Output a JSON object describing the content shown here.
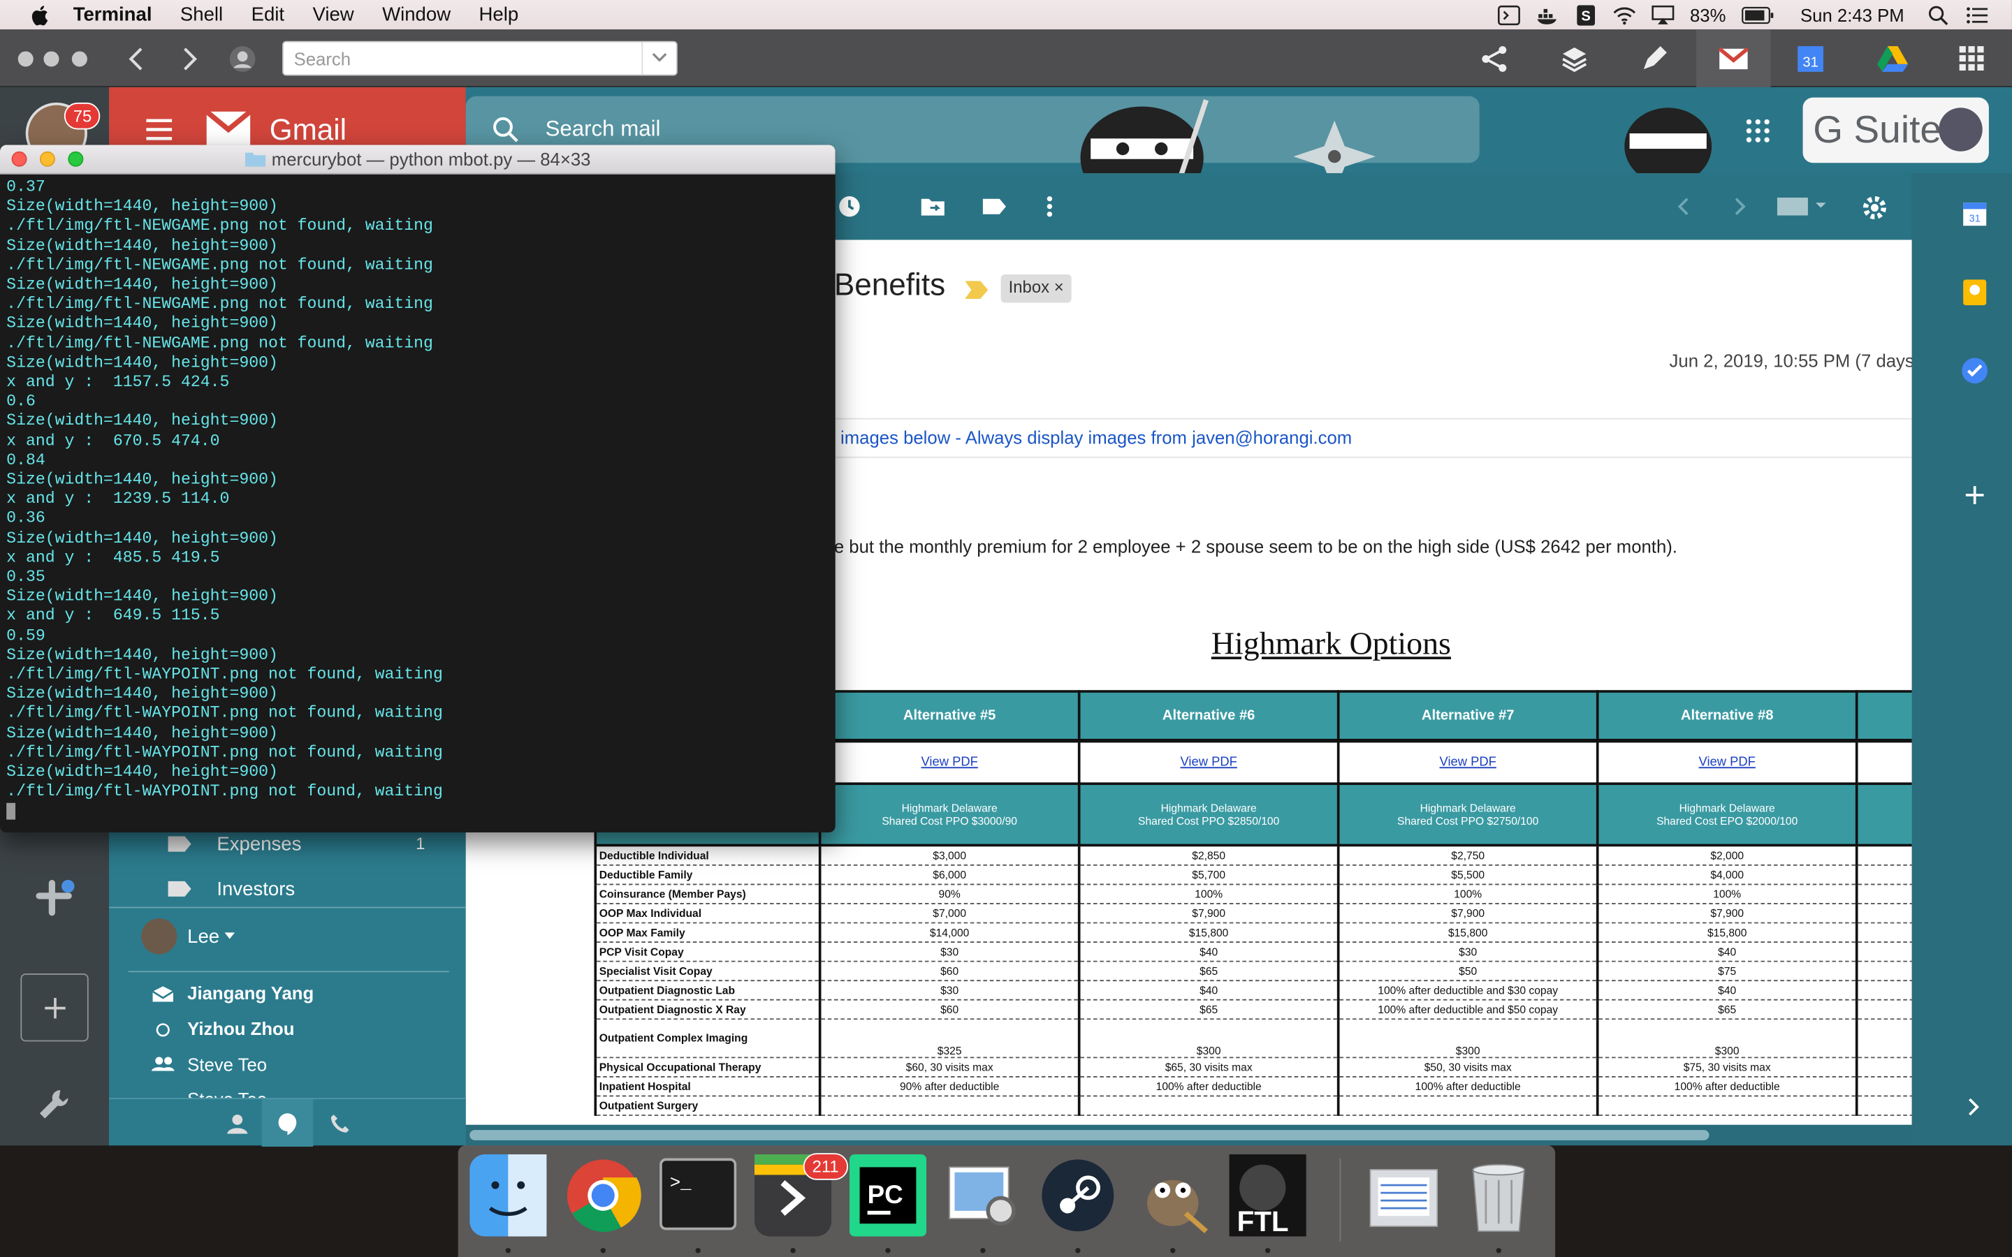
{
  "menubar": {
    "app_name": "Terminal",
    "menus": [
      "Shell",
      "Edit",
      "View",
      "Window",
      "Help"
    ],
    "battery": "83%",
    "clock": "Sun 2:43 PM"
  },
  "browser": {
    "search_placeholder": "Search"
  },
  "gmail": {
    "brand": "Gmail",
    "search_placeholder": "Search mail",
    "notification_count": "75",
    "gsuite": "G Suite",
    "email_subject_fragment": "Benefits",
    "inbox_chip": "Inbox ×",
    "date": "Jun 2, 2019, 10:55 PM (7 days",
    "images_notice_a": "images below - ",
    "images_notice_b": "Always display images from javen@horangi.com",
    "body_line": "e but the monthly premium for 2 employee + 2 spouse seem to be on the high side (US$ 2642 per month).",
    "highmark_title": "Highmark Options",
    "labels": [
      {
        "name": "Expenses",
        "count": "1"
      },
      {
        "name": "Investors",
        "count": ""
      }
    ],
    "hangouts_user": "Lee",
    "chats": [
      "Jiangang Yang",
      "Yizhou Zhou",
      "Steve Teo",
      "Steve Teo"
    ]
  },
  "plan_table": {
    "alternatives": [
      "Alternative #5",
      "Alternative #6",
      "Alternative #7",
      "Alternative #8"
    ],
    "view_pdf": "View PDF",
    "plan_names": [
      [
        "Highmark Delaware",
        "Shared Cost PPO $3000/90"
      ],
      [
        "Highmark Delaware",
        "Shared Cost PPO $2850/100"
      ],
      [
        "Highmark Delaware",
        "Shared Cost PPO $2750/100"
      ],
      [
        "Highmark Delaware",
        "Shared Cost EPO $2000/100"
      ]
    ],
    "rows": [
      {
        "label": "Deductible Individual",
        "values": [
          "$3,000",
          "$2,850",
          "$2,750",
          "$2,000"
        ]
      },
      {
        "label": "Deductible Family",
        "values": [
          "$6,000",
          "$5,700",
          "$5,500",
          "$4,000"
        ]
      },
      {
        "label": "Coinsurance (Member Pays)",
        "values": [
          "90%",
          "100%",
          "100%",
          "100%"
        ]
      },
      {
        "label": "OOP Max Individual",
        "values": [
          "$7,000",
          "$7,900",
          "$7,900",
          "$7,900"
        ]
      },
      {
        "label": "OOP Max Family",
        "values": [
          "$14,000",
          "$15,800",
          "$15,800",
          "$15,800"
        ]
      },
      {
        "label": "PCP Visit Copay",
        "values": [
          "$30",
          "$40",
          "$30",
          "$40"
        ]
      },
      {
        "label": "Specialist Visit Copay",
        "values": [
          "$60",
          "$65",
          "$50",
          "$75"
        ]
      },
      {
        "label": "Outpatient Diagnostic Lab",
        "values": [
          "$30",
          "$40",
          "100% after deductible and $30 copay",
          "$40"
        ]
      },
      {
        "label": "Outpatient Diagnostic X Ray",
        "values": [
          "$60",
          "$65",
          "100% after deductible and $50 copay",
          "$65"
        ]
      },
      {
        "label": "Outpatient Complex Imaging",
        "values": [
          "$325",
          "$300",
          "$300",
          "$300"
        ]
      },
      {
        "label": "Physical Occupational Therapy",
        "values": [
          "$60, 30 visits max",
          "$65, 30 visits max",
          "$50, 30 visits max",
          "$75, 30 visits max"
        ]
      },
      {
        "label": "Inpatient Hospital",
        "values": [
          "90% after deductible",
          "100% after deductible",
          "100% after deductible",
          "100% after deductible"
        ]
      },
      {
        "label": "Outpatient Surgery",
        "values": [
          "",
          "",
          "",
          ""
        ]
      }
    ]
  },
  "terminal": {
    "title": "mercurybot — python mbot.py — 84×33",
    "lines": [
      "0.37",
      "Size(width=1440, height=900)",
      "./ftl/img/ftl-NEWGAME.png not found, waiting",
      "Size(width=1440, height=900)",
      "./ftl/img/ftl-NEWGAME.png not found, waiting",
      "Size(width=1440, height=900)",
      "./ftl/img/ftl-NEWGAME.png not found, waiting",
      "Size(width=1440, height=900)",
      "./ftl/img/ftl-NEWGAME.png not found, waiting",
      "Size(width=1440, height=900)",
      "x and y :  1157.5 424.5",
      "0.6",
      "Size(width=1440, height=900)",
      "x and y :  670.5 474.0",
      "0.84",
      "Size(width=1440, height=900)",
      "x and y :  1239.5 114.0",
      "0.36",
      "Size(width=1440, height=900)",
      "x and y :  485.5 419.5",
      "0.35",
      "Size(width=1440, height=900)",
      "x and y :  649.5 115.5",
      "0.59",
      "Size(width=1440, height=900)",
      "./ftl/img/ftl-WAYPOINT.png not found, waiting",
      "Size(width=1440, height=900)",
      "./ftl/img/ftl-WAYPOINT.png not found, waiting",
      "Size(width=1440, height=900)",
      "./ftl/img/ftl-WAYPOINT.png not found, waiting",
      "Size(width=1440, height=900)",
      "./ftl/img/ftl-WAYPOINT.png not found, waiting"
    ]
  },
  "dock": {
    "items": [
      {
        "name": "Finder",
        "icon": "finder-icon",
        "color": "#4aa3f0",
        "badge": ""
      },
      {
        "name": "Chrome",
        "icon": "chrome-icon",
        "color": "#ffffff",
        "badge": ""
      },
      {
        "name": "Terminal",
        "icon": "terminal-icon",
        "color": "#1c1c1c",
        "badge": ""
      },
      {
        "name": "Prompt",
        "icon": "prompt-icon",
        "color": "#3a3a3c",
        "badge": "211"
      },
      {
        "name": "PyCharm",
        "icon": "pycharm-icon",
        "color": "#21d789",
        "badge": ""
      },
      {
        "name": "Preview",
        "icon": "preview-icon",
        "color": "#9bc3e6",
        "badge": ""
      },
      {
        "name": "Steam",
        "icon": "steam-icon",
        "color": "#1b2838",
        "badge": ""
      },
      {
        "name": "GIMP",
        "icon": "gimp-icon",
        "color": "#6e5b45",
        "badge": ""
      },
      {
        "name": "FTL",
        "icon": "ftl-icon",
        "color": "#141414",
        "badge": ""
      },
      {
        "name": "Documents",
        "icon": "documents-icon",
        "color": "#d9dde2",
        "badge": ""
      },
      {
        "name": "Trash",
        "icon": "trash-icon",
        "color": "#cfd3d6",
        "badge": ""
      }
    ]
  },
  "colors": {
    "terminal_text": "#67e5e9",
    "gmail_teal": "#266e80",
    "gmail_red": "#d1453b"
  }
}
